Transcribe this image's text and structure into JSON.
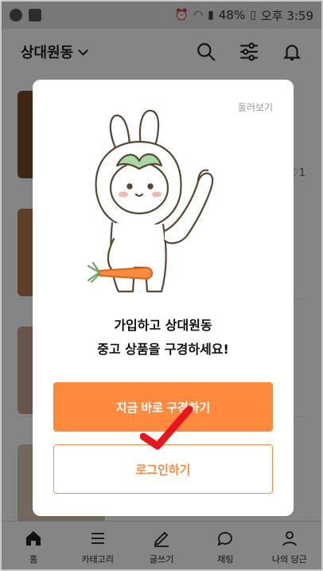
{
  "statusbar": {
    "battery": "48%",
    "time": "오후 3:59"
  },
  "header": {
    "location": "상대원동"
  },
  "feed": {
    "like_count": "1"
  },
  "modal": {
    "browse_link": "둘러보기",
    "headline_line1": "가입하고 상대원동",
    "headline_line2": "중고 상품을 구경하세요!",
    "primary_button": "지금 바로 구경하기",
    "login_button": "로그인하기"
  },
  "bottom_nav": {
    "items": [
      {
        "label": "홈",
        "icon": "home-icon"
      },
      {
        "label": "카테고리",
        "icon": "menu-icon"
      },
      {
        "label": "글쓰기",
        "icon": "pencil-icon"
      },
      {
        "label": "채팅",
        "icon": "chat-icon"
      },
      {
        "label": "나의 당근",
        "icon": "user-icon"
      }
    ]
  },
  "colors": {
    "accent": "#ff8a3d",
    "overlay": "#000000"
  }
}
